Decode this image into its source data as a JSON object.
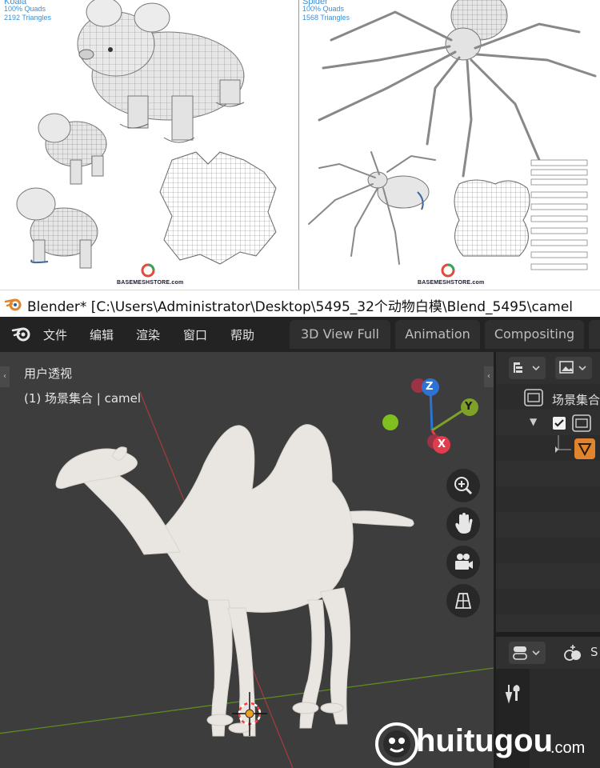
{
  "preview": {
    "left": {
      "title": "Koala",
      "quads": "100% Quads",
      "triangles": "2192 Triangles",
      "logo": "BASEMESHSTORE.com"
    },
    "right": {
      "title": "Spider",
      "quads": "100% Quads",
      "triangles": "1568 Triangles",
      "logo": "BASEMESHSTORE.com"
    }
  },
  "window": {
    "title": "Blender* [C:\\Users\\Administrator\\Desktop\\5495_32个动物白模\\Blend_5495\\camel"
  },
  "menu": {
    "items": [
      "文件",
      "编辑",
      "渲染",
      "窗口",
      "帮助"
    ]
  },
  "workspaces": {
    "tabs": [
      "3D View Full",
      "Animation",
      "Compositing"
    ]
  },
  "viewport": {
    "view_name": "用户透视",
    "collection_info": "(1) 场景集合 | camel",
    "gizmo": {
      "z": "Z",
      "y": "Y",
      "x": "X"
    },
    "colors": {
      "x_axis": "#e23d4f",
      "y_axis": "#7fa128",
      "z_axis": "#2d73d4",
      "floor_grid_x": "#b03a3a",
      "floor_grid_y": "#6e9a28"
    }
  },
  "outliner": {
    "scene_collection": "场景集合"
  },
  "properties": {
    "label": "S"
  },
  "watermark": {
    "brand": "huitugou",
    "suffix": ".com"
  },
  "accent": "#e0852e"
}
